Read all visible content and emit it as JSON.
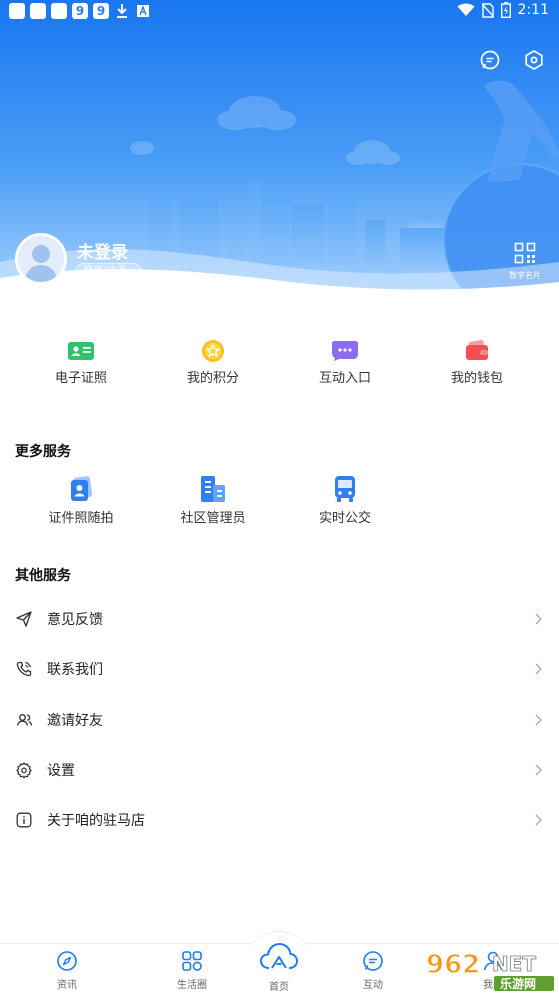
{
  "status_bar": {
    "time": "2:11"
  },
  "header": {
    "login_title": "未登录",
    "login_button": "登录/注册",
    "card_label": "数字名片"
  },
  "quick_actions": [
    {
      "label": "电子证照",
      "icon": "id-card-icon"
    },
    {
      "label": "我的积分",
      "icon": "points-star-icon"
    },
    {
      "label": "互动入口",
      "icon": "chat-bubble-icon"
    },
    {
      "label": "我的钱包",
      "icon": "wallet-icon"
    }
  ],
  "more_services": {
    "title": "更多服务",
    "items": [
      {
        "label": "证件照随拍",
        "icon": "id-photo-icon"
      },
      {
        "label": "社区管理员",
        "icon": "building-icon"
      },
      {
        "label": "实时公交",
        "icon": "bus-icon"
      }
    ]
  },
  "other_services": {
    "title": "其他服务",
    "items": [
      {
        "label": "意见反馈",
        "icon": "send-icon"
      },
      {
        "label": "联系我们",
        "icon": "phone-icon"
      },
      {
        "label": "邀请好友",
        "icon": "users-icon"
      },
      {
        "label": "设置",
        "icon": "gear-icon"
      },
      {
        "label": "关于咱的驻马店",
        "icon": "info-icon"
      }
    ]
  },
  "bottom_nav": [
    {
      "label": "资讯",
      "icon": "compass-icon"
    },
    {
      "label": "生活圈",
      "icon": "grid-icon"
    },
    {
      "label": "首页",
      "icon": "home-cloud-icon"
    },
    {
      "label": "互动",
      "icon": "message-icon"
    },
    {
      "label": "我的",
      "icon": "profile-icon"
    }
  ],
  "watermark": {
    "text1": "962",
    "text2": "NET",
    "text3": "乐游网"
  },
  "colors": {
    "accent": "#1f7cf2",
    "header_top": "#1877f0",
    "header_bottom": "#7fbcfb"
  }
}
